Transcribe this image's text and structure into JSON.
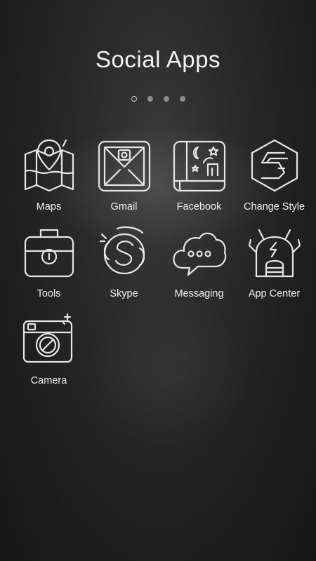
{
  "page": {
    "title": "Social Apps"
  },
  "pager": {
    "count": 4,
    "active": 0
  },
  "apps": [
    {
      "label": "Maps",
      "icon": "map-pin-icon"
    },
    {
      "label": "Gmail",
      "icon": "envelope-icon"
    },
    {
      "label": "Facebook",
      "icon": "night-book-icon"
    },
    {
      "label": "Change Style",
      "icon": "hexagon-s-icon"
    },
    {
      "label": "Tools",
      "icon": "toolbox-icon"
    },
    {
      "label": "Skype",
      "icon": "skype-icon"
    },
    {
      "label": "Messaging",
      "icon": "chat-cloud-icon"
    },
    {
      "label": "App Center",
      "icon": "robot-icon"
    },
    {
      "label": "Camera",
      "icon": "camera-icon"
    }
  ]
}
